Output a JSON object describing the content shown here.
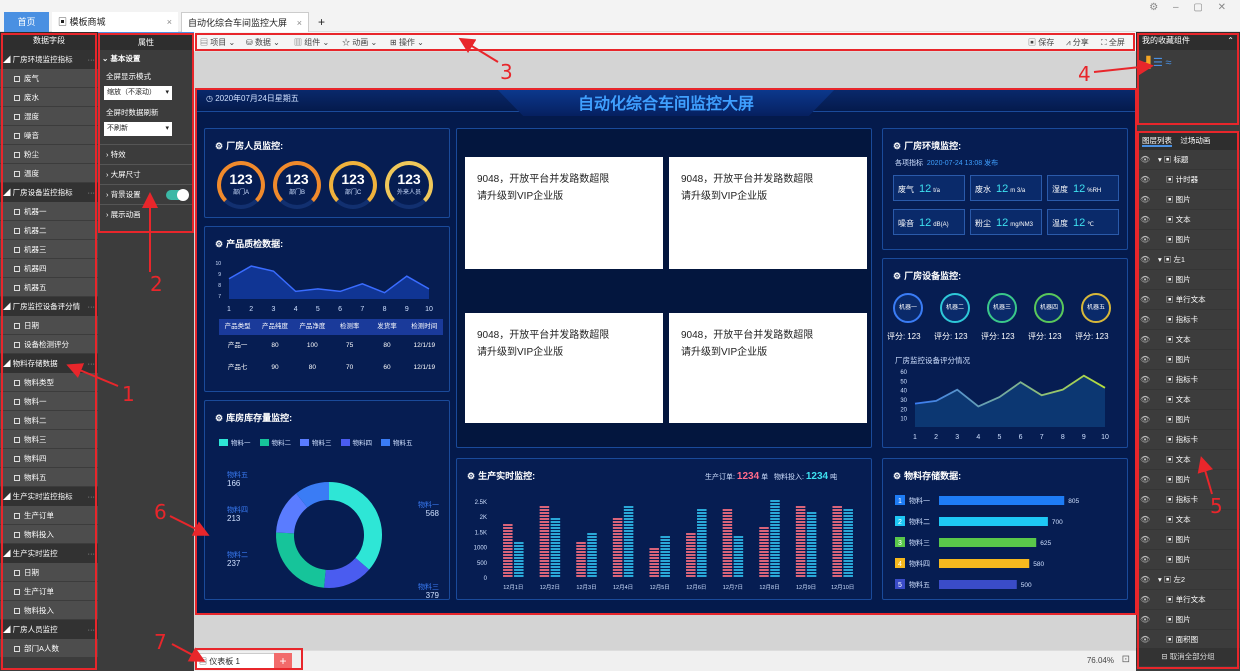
{
  "tabs": {
    "home": "首页",
    "template": "模板商城",
    "active": "自动化综合车间监控大屏",
    "add": "+"
  },
  "left": {
    "header": "数据字段",
    "groups": [
      {
        "name": "厂房环境监控指标",
        "fields": [
          "废气",
          "废水",
          "湿度",
          "噪音",
          "粉尘",
          "温度"
        ]
      },
      {
        "name": "厂房设备监控指标",
        "fields": [
          "机器一",
          "机器二",
          "机器三",
          "机器四",
          "机器五"
        ]
      },
      {
        "name": "厂房监控设备评分情",
        "fields": [
          "日期",
          "设备检测评分"
        ]
      },
      {
        "name": "物料存储数据",
        "fields": [
          "物料类型",
          "物料一",
          "物料二",
          "物料三",
          "物料四",
          "物料五"
        ]
      },
      {
        "name": "生产实时监控指标",
        "fields": [
          "生产订单",
          "物料投入"
        ]
      },
      {
        "name": "生产实时监控",
        "fields": [
          "日期",
          "生产订单",
          "物料投入"
        ]
      },
      {
        "name": "厂房人员监控",
        "fields": [
          "部门A人数"
        ]
      }
    ]
  },
  "props": {
    "header": "属性",
    "basic": "基本设置",
    "fullscreen_mode": "全屏显示模式",
    "fullscreen_value": "缩放（不滚动）",
    "refresh": "全屏时数据刷新",
    "refresh_value": "不刷新",
    "effects": "特效",
    "size": "大屏尺寸",
    "bg": "背景设置",
    "anim": "展示动画"
  },
  "toolbar": {
    "items": [
      "项目",
      "数据",
      "组件",
      "动画",
      "操作"
    ],
    "save": "保存",
    "share": "分享",
    "fullscreen": "全屏"
  },
  "screen": {
    "date": "2020年07月24日星期五",
    "title": "自动化综合车间监控大屏",
    "personnel": {
      "title": "厂房人员监控:",
      "gauges": [
        {
          "value": "123",
          "label": "部门A"
        },
        {
          "value": "123",
          "label": "部门B"
        },
        {
          "value": "123",
          "label": "部门C"
        },
        {
          "value": "123",
          "label": "外来人员"
        }
      ]
    },
    "quality": {
      "title": "产品质检数据:",
      "xticks": [
        "1",
        "2",
        "3",
        "4",
        "5",
        "6",
        "7",
        "8",
        "9",
        "10"
      ],
      "yticks": [
        "10",
        "9",
        "8",
        "7"
      ],
      "headers": [
        "产品类型",
        "产品纯度",
        "产品净度",
        "检测率",
        "发货率",
        "检测时间"
      ],
      "rows": [
        [
          "产品一",
          "80",
          "100",
          "75",
          "80",
          "12/1/19"
        ],
        [
          "产品七",
          "90",
          "80",
          "70",
          "60",
          "12/1/19"
        ]
      ]
    },
    "inventory": {
      "title": "库房库存量监控:",
      "legend": [
        "物料一",
        "物料二",
        "物料三",
        "物料四",
        "物料五"
      ],
      "labels": [
        {
          "name": "物料五",
          "value": "166"
        },
        {
          "name": "物料四",
          "value": "213"
        },
        {
          "name": "物料二",
          "value": "237"
        },
        {
          "name": "物料一",
          "value": "568"
        },
        {
          "name": "物料三",
          "value": "379"
        }
      ]
    },
    "vip": {
      "line1": "9048，开放平台并发路数超限",
      "line2": "请升级到VIP企业版"
    },
    "production": {
      "title": "生产实时监控:",
      "orders_label": "生产订单:",
      "orders_value": "1234",
      "orders_unit": "单",
      "input_label": "物料投入:",
      "input_value": "1234",
      "input_unit": "吨",
      "yticks": [
        "2.5K",
        "2K",
        "1.5K",
        "1000",
        "500",
        "0"
      ],
      "dates": [
        "12月1日",
        "12月2日",
        "12月3日",
        "12月4日",
        "12月5日",
        "12月6日",
        "12月7日",
        "12月8日",
        "12月9日",
        "12月10日"
      ]
    },
    "environment": {
      "title": "厂房环境监控:",
      "subtitle": "各项指标",
      "time": "2020-07-24 13:08 发布",
      "items": [
        {
          "name": "废气",
          "value": "12",
          "unit": "t/a"
        },
        {
          "name": "废水",
          "value": "12",
          "unit": "m 3/a"
        },
        {
          "name": "湿度",
          "value": "12",
          "unit": "%RH"
        },
        {
          "name": "噪音",
          "value": "12",
          "unit": "dB(A)"
        },
        {
          "name": "粉尘",
          "value": "12",
          "unit": "mg/NM3"
        },
        {
          "name": "温度",
          "value": "12",
          "unit": "℃"
        }
      ]
    },
    "equipment": {
      "title": "厂房设备监控:",
      "machines": [
        "机器一",
        "机器二",
        "机器三",
        "机器四",
        "机器五"
      ],
      "score_label": "评分:",
      "score_value": "123",
      "chart_title": "厂房监控设备评分情况",
      "yticks": [
        "60",
        "50",
        "40",
        "30",
        "20",
        "10"
      ],
      "xticks": [
        "1",
        "2",
        "3",
        "4",
        "5",
        "6",
        "7",
        "8",
        "9",
        "10"
      ]
    },
    "materials": {
      "title": "物料存储数据:",
      "rows": [
        {
          "idx": "1",
          "name": "物料一",
          "value": "805"
        },
        {
          "idx": "2",
          "name": "物料二",
          "value": "700"
        },
        {
          "idx": "3",
          "name": "物料三",
          "value": "625"
        },
        {
          "idx": "4",
          "name": "物料四",
          "value": "580"
        },
        {
          "idx": "5",
          "name": "物料五",
          "value": "500"
        }
      ]
    }
  },
  "right": {
    "fav": "我的收藏组件",
    "layers_tab": "图层列表",
    "trans_tab": "过场动画",
    "layers": [
      "标题",
      "计时器",
      "图片",
      "文本",
      "图片",
      "左1",
      "图片",
      "单行文本",
      "指标卡",
      "文本",
      "图片",
      "指标卡",
      "文本",
      "图片",
      "指标卡",
      "文本",
      "图片",
      "指标卡",
      "文本",
      "图片",
      "图片",
      "左2",
      "单行文本",
      "图片",
      "面积图"
    ],
    "cancel": "取消全部分组"
  },
  "bottom": {
    "sheet": "仪表板 1",
    "zoom": "76.04%"
  },
  "annotations": [
    "1",
    "2",
    "3",
    "4",
    "5",
    "6",
    "7"
  ],
  "colors": {
    "accent": "#4a90e2",
    "red": "#e8262b",
    "screen_bg": "#041a4c"
  },
  "chart_data": [
    {
      "type": "area",
      "title": "",
      "x": [
        1,
        2,
        3,
        4,
        5,
        6,
        7,
        8,
        9,
        10
      ],
      "values": [
        8.6,
        9.6,
        9.2,
        7.6,
        7.8,
        7.6,
        8.2,
        7.5,
        8.8,
        7.8
      ],
      "ylim": [
        7,
        10
      ]
    },
    {
      "type": "pie",
      "categories": [
        "物料一",
        "物料二",
        "物料三",
        "物料四",
        "物料五"
      ],
      "values": [
        568,
        237,
        379,
        213,
        166
      ]
    },
    {
      "type": "bar",
      "categories": [
        "12月1日",
        "12月2日",
        "12月3日",
        "12月4日",
        "12月5日",
        "12月6日",
        "12月7日",
        "12月8日",
        "12月9日",
        "12月10日"
      ],
      "series": [
        {
          "name": "生产订单",
          "values": [
            1800,
            2400,
            1200,
            2000,
            1000,
            1500,
            2300,
            1700,
            2400,
            2400
          ]
        },
        {
          "name": "物料投入",
          "values": [
            1200,
            2000,
            1500,
            2400,
            1400,
            2300,
            1400,
            2600,
            2200,
            2300
          ]
        }
      ],
      "ylim": [
        0,
        2500
      ]
    },
    {
      "type": "area",
      "x": [
        1,
        2,
        3,
        4,
        5,
        6,
        7,
        8,
        9,
        10
      ],
      "values": [
        25,
        28,
        40,
        22,
        32,
        48,
        34,
        40,
        55,
        42
      ],
      "ylim": [
        0,
        60
      ]
    },
    {
      "type": "bar",
      "categories": [
        "物料一",
        "物料二",
        "物料三",
        "物料四",
        "物料五"
      ],
      "values": [
        805,
        700,
        625,
        580,
        500
      ]
    }
  ]
}
